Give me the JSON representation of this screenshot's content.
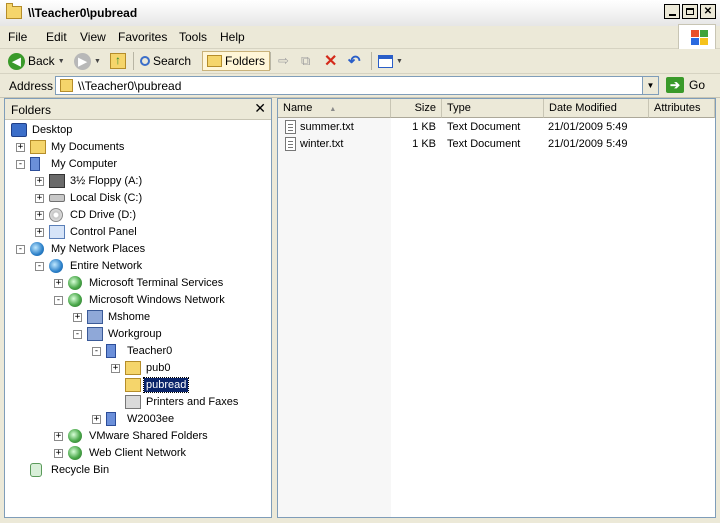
{
  "window": {
    "title": "\\\\Teacher0\\pubread"
  },
  "menu": {
    "file": "File",
    "edit": "Edit",
    "view": "View",
    "favorites": "Favorites",
    "tools": "Tools",
    "help": "Help"
  },
  "toolbar": {
    "back": "Back",
    "search": "Search",
    "folders": "Folders"
  },
  "address": {
    "label": "Address",
    "value": "\\\\Teacher0\\pubread",
    "go": "Go"
  },
  "folders_pane": {
    "title": "Folders",
    "close": "✕",
    "tree": [
      {
        "label": "Desktop",
        "expander": "",
        "icon": "desktop-icon"
      },
      {
        "label": "My Documents",
        "expander": "+",
        "icon": "documents-folder-icon"
      },
      {
        "label": "My Computer",
        "expander": "−",
        "icon": "computer-icon"
      },
      {
        "label": "3½ Floppy (A:)",
        "expander": "+",
        "icon": "floppy-icon"
      },
      {
        "label": "Local Disk (C:)",
        "expander": "+",
        "icon": "hard-disk-icon"
      },
      {
        "label": "CD Drive (D:)",
        "expander": "+",
        "icon": "cd-drive-icon"
      },
      {
        "label": "Control Panel",
        "expander": "+",
        "icon": "control-panel-icon"
      },
      {
        "label": "My Network Places",
        "expander": "−",
        "icon": "network-places-icon"
      },
      {
        "label": "Entire Network",
        "expander": "−",
        "icon": "entire-network-icon"
      },
      {
        "label": "Microsoft Terminal Services",
        "expander": "+",
        "icon": "network-globe-icon"
      },
      {
        "label": "Microsoft Windows Network",
        "expander": "−",
        "icon": "network-globe-icon"
      },
      {
        "label": "Mshome",
        "expander": "+",
        "icon": "workgroup-icon"
      },
      {
        "label": "Workgroup",
        "expander": "−",
        "icon": "workgroup-icon"
      },
      {
        "label": "Teacher0",
        "expander": "−",
        "icon": "computer-icon"
      },
      {
        "label": "pub0",
        "expander": "+",
        "icon": "shared-folder-icon"
      },
      {
        "label": "pubread",
        "expander": "",
        "icon": "shared-folder-icon"
      },
      {
        "label": "Printers and Faxes",
        "expander": "",
        "icon": "printer-icon"
      },
      {
        "label": "W2003ee",
        "expander": "+",
        "icon": "computer-icon"
      },
      {
        "label": "VMware Shared Folders",
        "expander": "+",
        "icon": "network-globe-icon"
      },
      {
        "label": "Web Client Network",
        "expander": "+",
        "icon": "network-globe-icon"
      },
      {
        "label": "Recycle Bin",
        "expander": "",
        "icon": "recycle-bin-icon"
      }
    ]
  },
  "file_list": {
    "columns": {
      "name": "Name",
      "size": "Size",
      "type": "Type",
      "date": "Date Modified",
      "attributes": "Attributes"
    },
    "sort_indicator": "▲",
    "rows": [
      {
        "name": "summer.txt",
        "size": "1 KB",
        "type": "Text Document",
        "date": "21/01/2009 5:49",
        "attributes": ""
      },
      {
        "name": "winter.txt",
        "size": "1 KB",
        "type": "Text Document",
        "date": "21/01/2009 5:49",
        "attributes": ""
      }
    ]
  }
}
